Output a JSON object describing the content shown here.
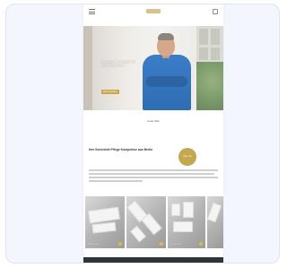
{
  "hero": {
    "title": "Das Selfcare Design auf Schönheits Care",
    "cta_label": "Jetzt ansehen"
  },
  "caption": "Unser Wert",
  "section": {
    "title": "Ihre Schönheit Pflege Kompetenz aus Berlin",
    "badge_label": "Über uns"
  },
  "gallery": [
    {
      "label": "Pflege Serie"
    },
    {
      "label": ""
    },
    {
      "label": "Sets & Kits"
    },
    {
      "label": ""
    }
  ],
  "colors": {
    "accent_gold": "#c4a84f",
    "scrubs_blue": "#3b7dc8",
    "footer": "#2f3435"
  },
  "icons": [
    "menu-icon",
    "shopping-bag-icon",
    "play-icon"
  ]
}
